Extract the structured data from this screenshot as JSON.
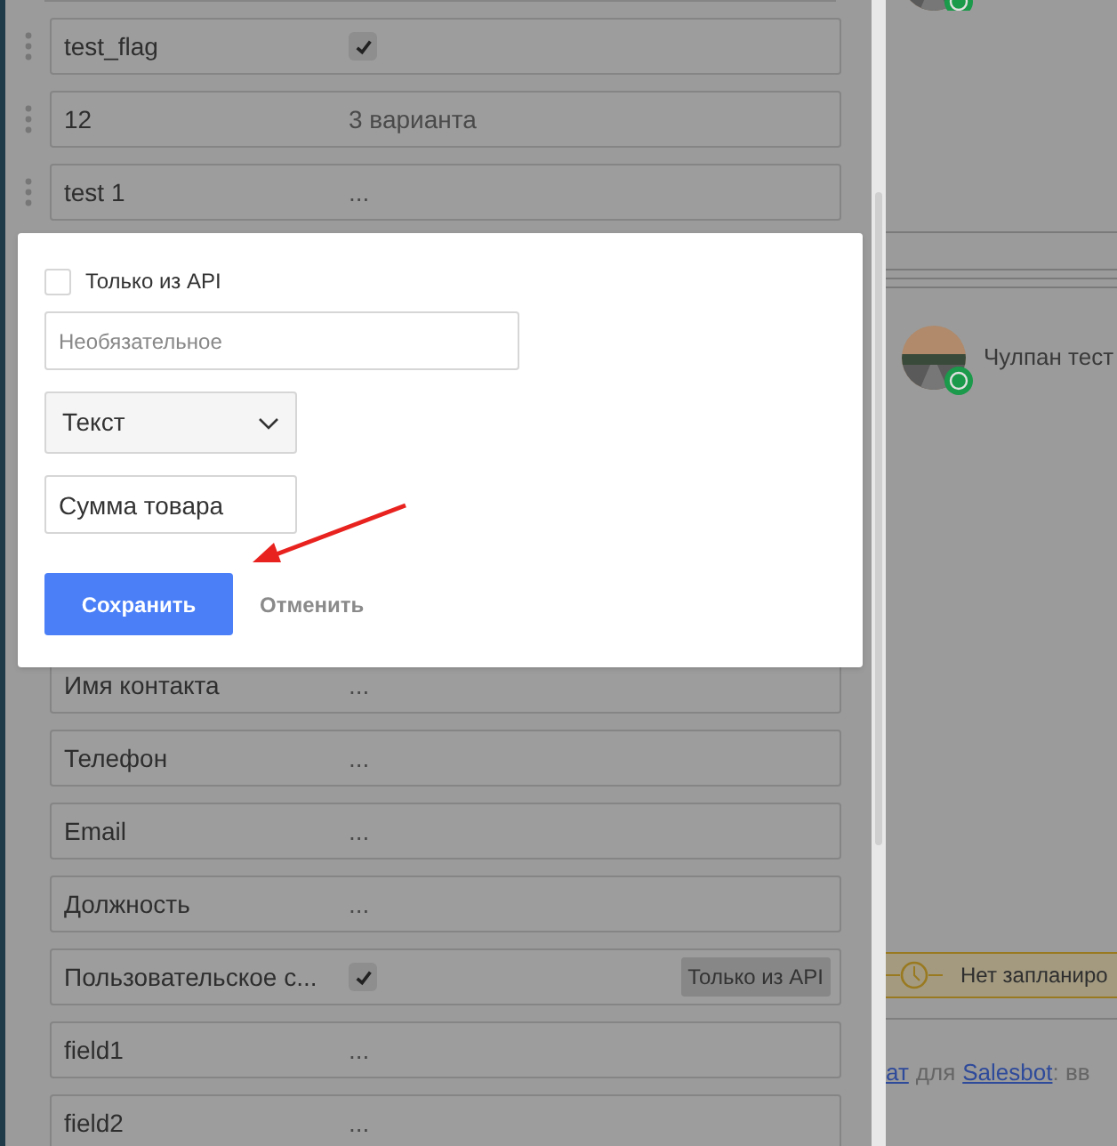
{
  "fields": [
    {
      "label": "test_flag",
      "kind": "checkbox",
      "checked": true,
      "draggable": true
    },
    {
      "label": "12",
      "kind": "text",
      "value": "3 варианта",
      "draggable": true
    },
    {
      "label": "test 1",
      "kind": "text",
      "value": "...",
      "draggable": true
    },
    {
      "label": "Имя контакта",
      "kind": "text",
      "value": "...",
      "draggable": false,
      "gap_before": true
    },
    {
      "label": "Телефон",
      "kind": "text",
      "value": "...",
      "draggable": false
    },
    {
      "label": "Email",
      "kind": "text",
      "value": "...",
      "draggable": false
    },
    {
      "label": "Должность",
      "kind": "text",
      "value": "...",
      "draggable": false
    },
    {
      "label": "Пользовательское с...",
      "kind": "checkbox",
      "checked": true,
      "draggable": false,
      "badge": "Только из API"
    },
    {
      "label": "field1",
      "kind": "text",
      "value": "...",
      "draggable": false
    },
    {
      "label": "field2",
      "kind": "text",
      "value": "...",
      "draggable": false
    }
  ],
  "dialog": {
    "api_only": {
      "label": "Только из API",
      "checked": false
    },
    "name_field": {
      "placeholder": "Необязательное"
    },
    "type_select": {
      "value": "Текст"
    },
    "title_field": {
      "value": "Сумма товара"
    },
    "save_button": "Сохранить",
    "cancel_button": "Отменить"
  },
  "chat": {
    "contact_name": "Чулпан тест",
    "notice": "Нет запланиро",
    "footer": {
      "link_1": "ат",
      "word": "для",
      "link_2": "Salesbot",
      "rest": ": вв"
    }
  }
}
